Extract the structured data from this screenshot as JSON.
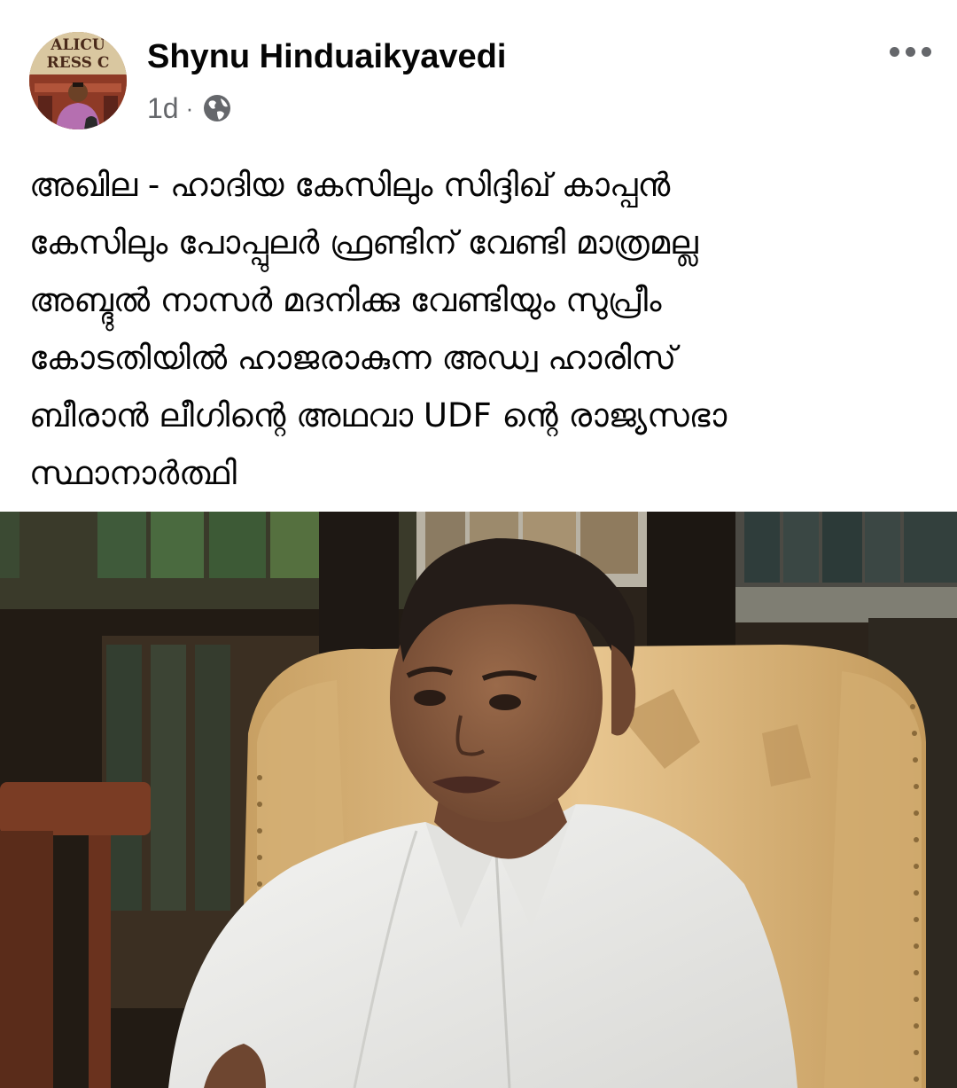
{
  "post": {
    "author": {
      "name": "Shynu Hinduaikyavedi",
      "avatar_sign_text": "ALICU PRESS C"
    },
    "timestamp": "1d",
    "separator": "·",
    "privacy_icon": "globe-icon",
    "more_icon": "more-horizontal-icon",
    "text_lines": [
      "അഖില - ഹാദിയ കേസിലും സിദ്ദിഖ് കാപ്പൻ",
      "കേസിലും പോപ്പുലർ ഫ്രണ്ടിന് വേണ്ടി മാത്രമല്ല",
      "അബ്ദുൽ നാസർ മദനിക്കു വേണ്ടിയും സുപ്രീം",
      "കോടതിയിൽ ഹാജരാകുന്ന അഡ്വ ഹാരിസ്",
      "ബീരാൻ ലീഗിന്റെ അഥവാ UDF ന്റെ രാജ്യസഭാ",
      "സ്ഥാനാർത്ഥി"
    ]
  },
  "colors": {
    "text_primary": "#050505",
    "text_secondary": "#65676b",
    "background": "#ffffff"
  }
}
